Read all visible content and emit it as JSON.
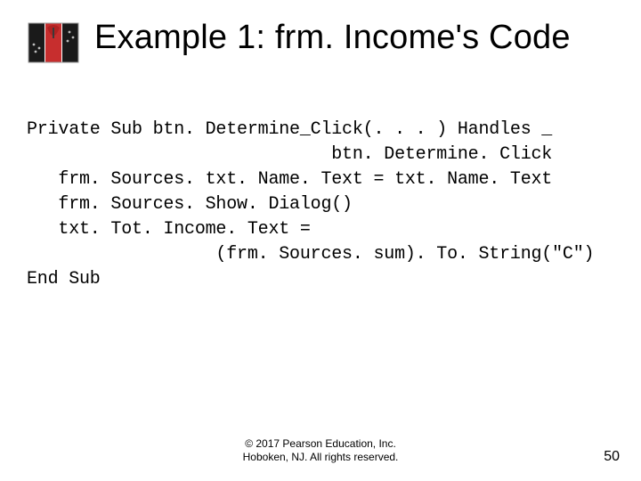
{
  "header": {
    "title": "Example 1: frm. Income's Code"
  },
  "code": {
    "l1": "Private Sub btn. Determine_Click(. . . ) Handles _",
    "l2": "                             btn. Determine. Click",
    "l3": "   frm. Sources. txt. Name. Text = txt. Name. Text",
    "l4": "   frm. Sources. Show. Dialog()",
    "l5": "   txt. Tot. Income. Text =",
    "l6": "                  (frm. Sources. sum). To. String(\"C\")",
    "l7": "End Sub"
  },
  "footer": {
    "copyright_l1": "© 2017 Pearson Education, Inc.",
    "copyright_l2": "Hoboken, NJ. All rights reserved.",
    "page": "50"
  }
}
